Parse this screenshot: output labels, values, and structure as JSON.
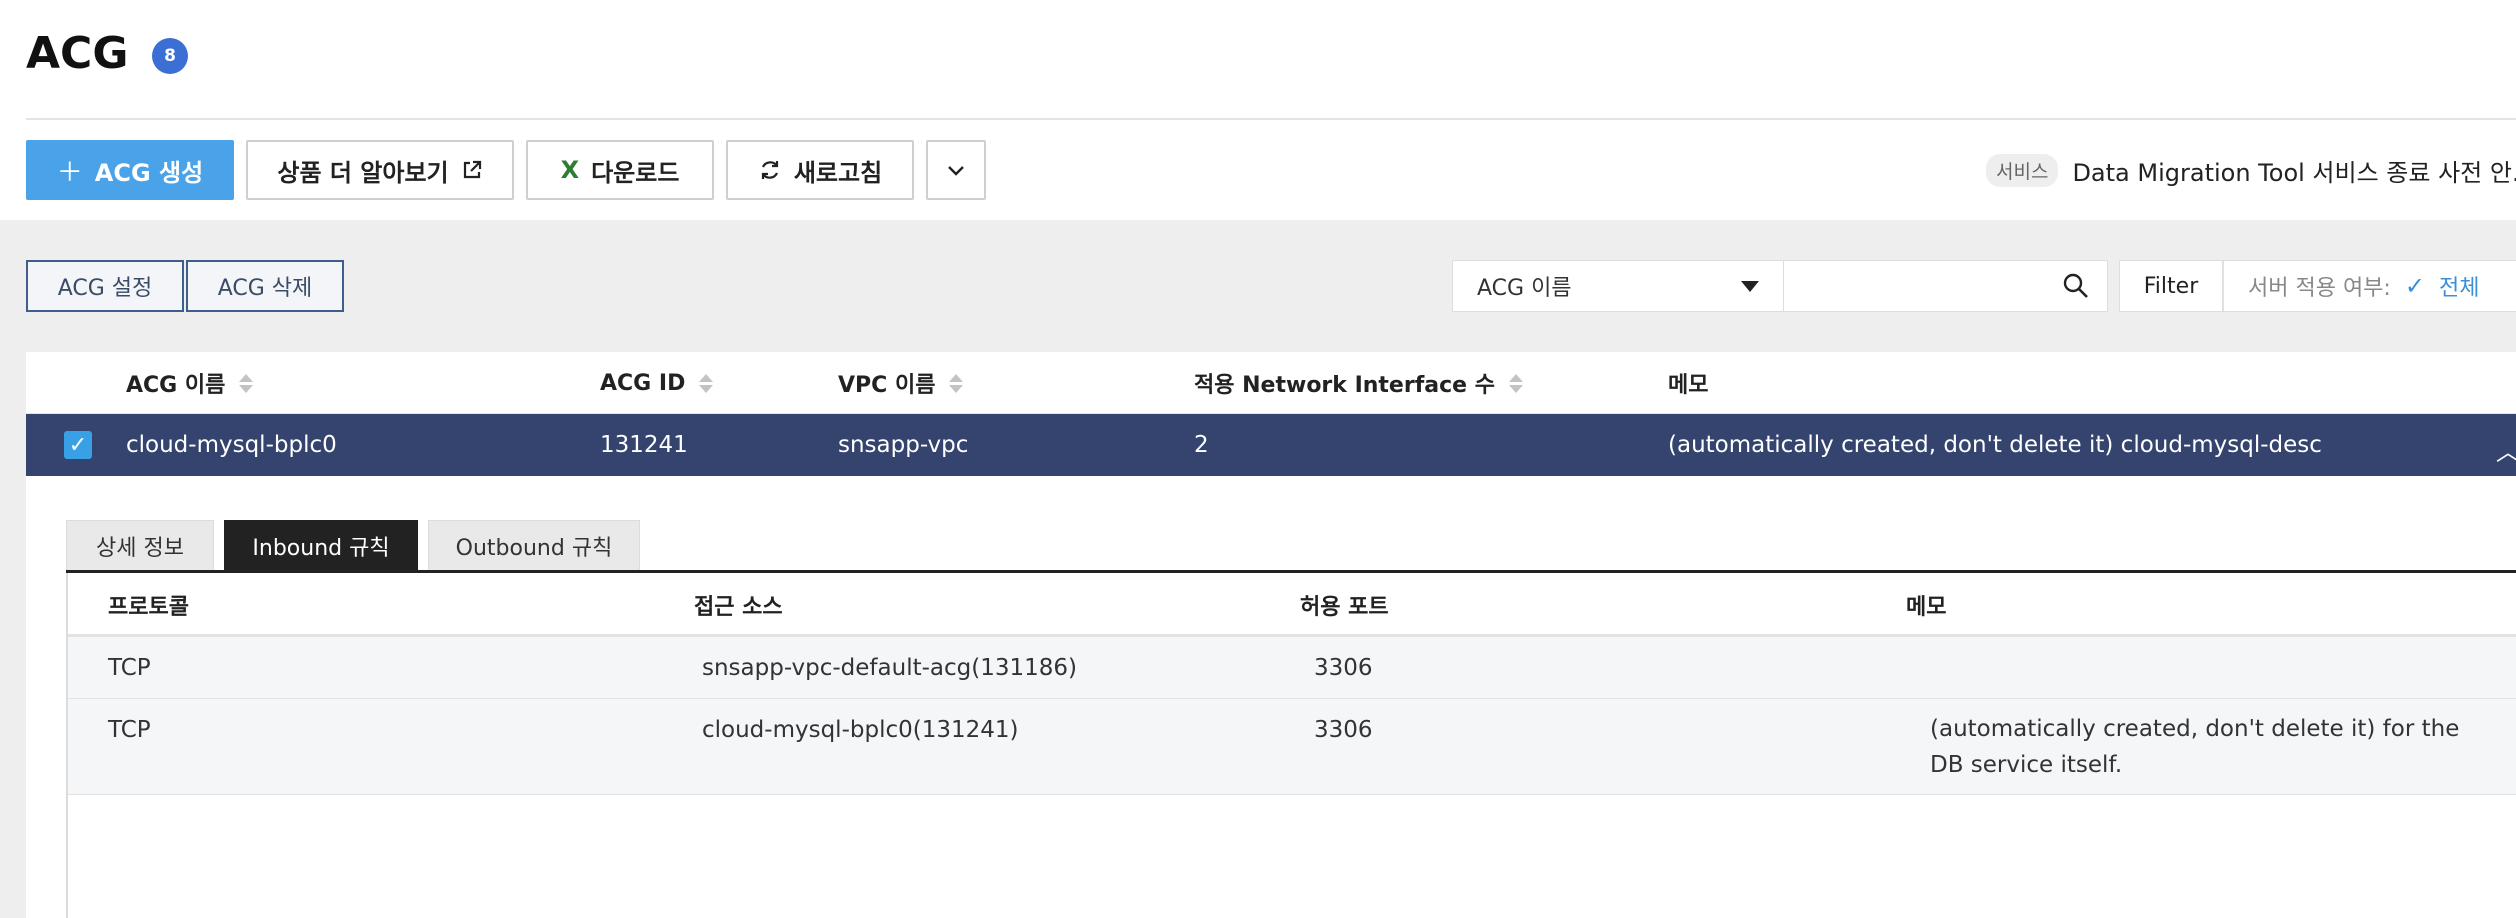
{
  "header": {
    "title": "ACG",
    "count": "8"
  },
  "toolbar": {
    "create_label": "ACG 생성",
    "learn_more_label": "상품 더 알아보기",
    "download_label": "다운로드",
    "refresh_label": "새로고침"
  },
  "notice": {
    "tag": "서비스",
    "text": "Data Migration Tool 서비스 종료 사전 안..."
  },
  "actions": {
    "settings_label": "ACG 설정",
    "delete_label": "ACG 삭제"
  },
  "search": {
    "field_selected": "ACG 이름",
    "placeholder": ""
  },
  "filter": {
    "label": "Filter",
    "status_label": "서버 적용 여부:",
    "status_value": "전체"
  },
  "table": {
    "columns": [
      "ACG 이름",
      "ACG ID",
      "VPC 이름",
      "적용 Network Interface 수",
      "메모"
    ],
    "selected_row": {
      "name": "cloud-mysql-bplc0",
      "id": "131241",
      "vpc": "snsapp-vpc",
      "ni_count": "2",
      "memo": "(automatically created, don't delete it) cloud-mysql-desc"
    }
  },
  "detail": {
    "tabs": [
      "상세 정보",
      "Inbound 규칙",
      "Outbound 규칙"
    ],
    "active_tab": "Inbound 규칙",
    "rule_columns": [
      "프로토콜",
      "접근 소스",
      "허용 포트",
      "메모"
    ],
    "rules": [
      {
        "protocol": "TCP",
        "source": "snsapp-vpc-default-acg(131186)",
        "port": "3306",
        "memo": ""
      },
      {
        "protocol": "TCP",
        "source": "cloud-mysql-bplc0(131241)",
        "port": "3306",
        "memo": "(automatically created, don't delete it) for the DB service itself."
      }
    ]
  },
  "colors": {
    "accent": "#4aa3e8",
    "selected_row": "#34446e",
    "badge": "#3b6fd4"
  }
}
